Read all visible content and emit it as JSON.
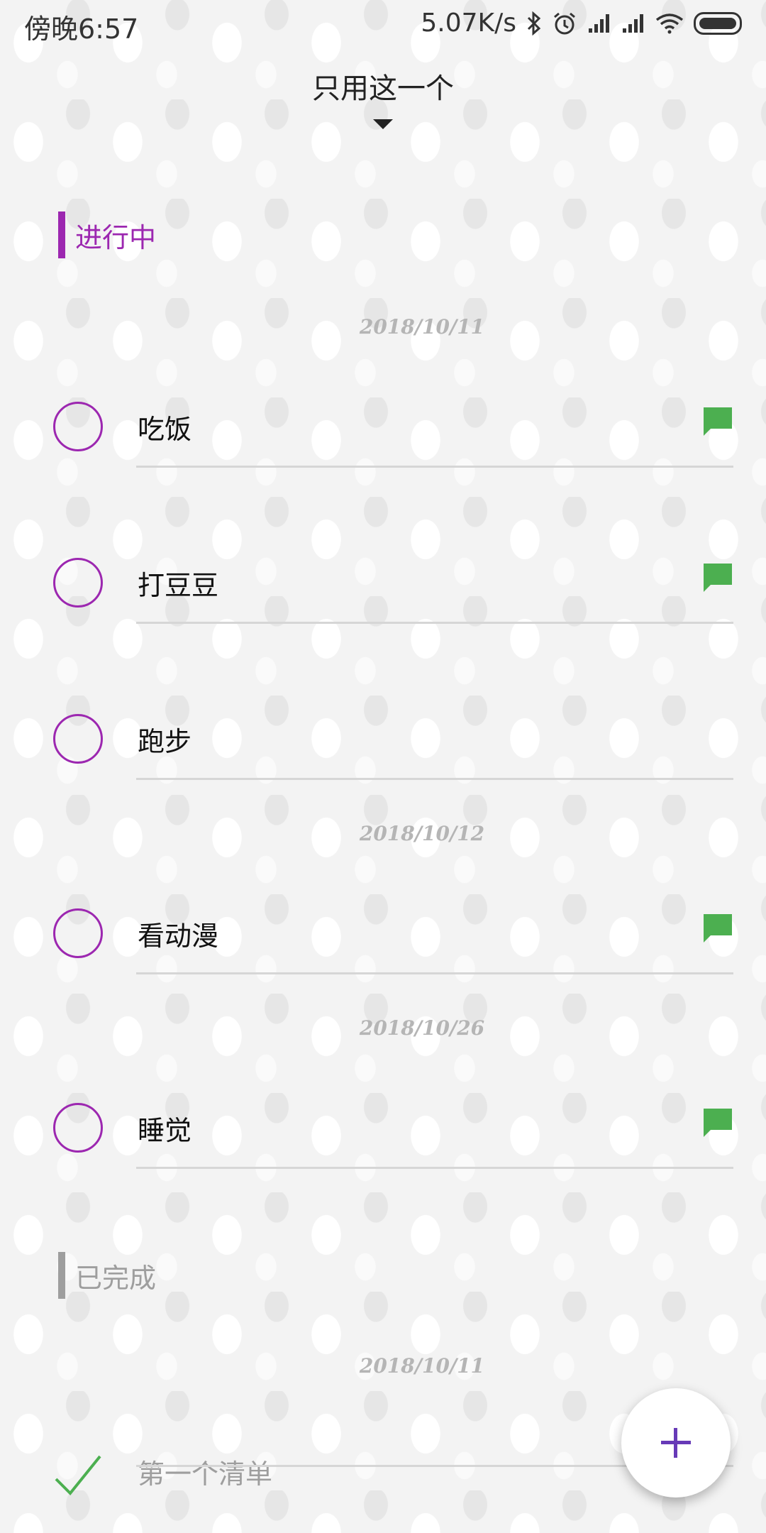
{
  "status": {
    "time": "傍晚6:57",
    "net_speed": "5.07K/s",
    "icons": [
      "bluetooth-icon",
      "alarm-icon",
      "signal-icon",
      "signal-icon",
      "wifi-icon",
      "battery-icon"
    ]
  },
  "header": {
    "title": "只用这一个",
    "dropdown_icon": "caret-down-icon"
  },
  "colors": {
    "accent": "#9c27b0",
    "note": "#4caf50",
    "done_bar": "#9e9e9e",
    "fab_plus": "#673ab7"
  },
  "sections": {
    "in_progress": {
      "label": "进行中",
      "dates": [
        "2018/10/11",
        "2018/10/12",
        "2018/10/26"
      ],
      "items": [
        {
          "text": "吃饭",
          "has_note": true
        },
        {
          "text": "打豆豆",
          "has_note": true
        },
        {
          "text": "跑步",
          "has_note": false
        },
        {
          "text": "看动漫",
          "has_note": true
        },
        {
          "text": "睡觉",
          "has_note": true
        }
      ]
    },
    "done": {
      "label": "已完成",
      "dates": [
        "2018/10/11"
      ],
      "items": [
        {
          "text": "第一个清单"
        }
      ]
    }
  },
  "fab": {
    "icon": "plus-icon"
  }
}
